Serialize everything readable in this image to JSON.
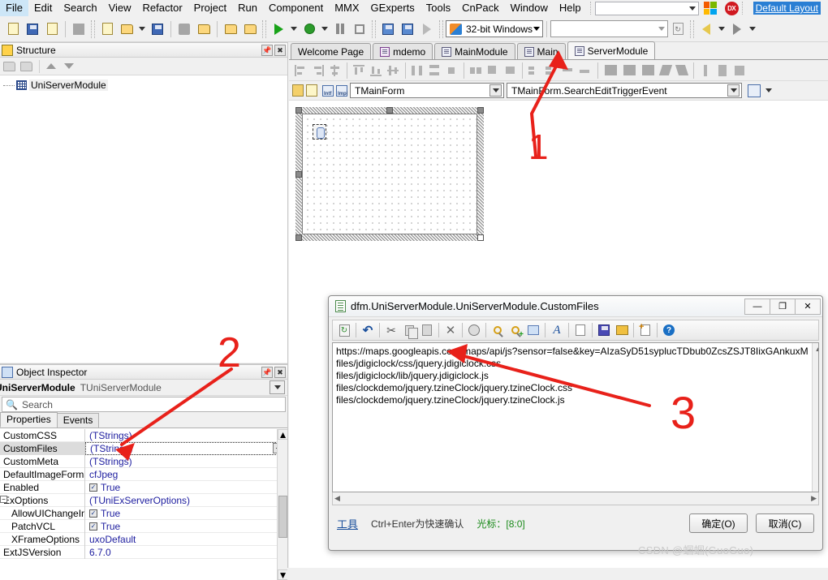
{
  "menubar": {
    "items": [
      "File",
      "Edit",
      "Search",
      "View",
      "Refactor",
      "Project",
      "Run",
      "Component",
      "MMX",
      "GExperts",
      "Tools",
      "CnPack",
      "Window",
      "Help"
    ],
    "combo_value": "",
    "layout_label": "Default Layout",
    "dx_badge": "DX"
  },
  "toolbar": {
    "platform_combo": "32-bit Windows",
    "config_combo": "",
    "icons": [
      "open-file-icon",
      "open-project-icon",
      "reopen-icon",
      "stop-icon",
      "new-icon",
      "new-other-icon",
      "save-icon",
      "close-icon",
      "close-all-icon",
      "save-all-icon",
      "save-project-icon",
      "run-icon",
      "run-options-icon",
      "debug-icon",
      "debug-options-icon",
      "pause-icon",
      "program-reset-icon",
      "trace-into-icon",
      "step-over-icon",
      "run-to-cursor-icon",
      "vista-platform-icon",
      "refresh-icon",
      "back-icon",
      "forward-icon"
    ]
  },
  "structure": {
    "title": "Structure",
    "pin_icon": "pin-icon",
    "close_icon": "close-icon",
    "tools": [
      "collapse-icon",
      "expand-icon",
      "move-up-icon",
      "move-down-icon"
    ],
    "tree": [
      {
        "label": "UniServerModule",
        "icon": "module-grid-icon"
      }
    ]
  },
  "editor": {
    "tabs": [
      {
        "label": "Welcome Page",
        "icon": null,
        "active": false
      },
      {
        "label": "mdemo",
        "icon": "project-icon",
        "active": false
      },
      {
        "label": "MainModule",
        "icon": "form-icon",
        "active": false
      },
      {
        "label": "Main",
        "icon": "form-icon",
        "active": false
      },
      {
        "label": "ServerModule",
        "icon": "form-icon",
        "active": true
      }
    ],
    "class_combo": "TMainForm",
    "member_combo": "TMainForm.SearchEditTriggerEvent",
    "designer_icons": [
      "align-left-icon",
      "align-right-icon",
      "align-center-icon",
      "align-top-icon",
      "align-bottom-icon",
      "align-middle-icon",
      "space-h-icon",
      "space-v-icon",
      "center-h-icon",
      "center-v-icon",
      "scale-icon",
      "size-icon",
      "tab-order-icon",
      "creation-order-icon",
      "bring-front-icon",
      "send-back-icon",
      "lock-icon",
      "flip-children-icon",
      "grid-snap-icon",
      "grid-show-icon",
      "align-to-grid-icon"
    ]
  },
  "inspector": {
    "title": "Object Inspector",
    "pin_icon": "pin-icon",
    "close_icon": "close-icon",
    "object_name": "UniServerModule",
    "object_class": "TUniServerModule",
    "search_placeholder": "Search",
    "tabs": [
      {
        "label": "Properties",
        "active": true
      },
      {
        "label": "Events",
        "active": false
      }
    ],
    "rows": [
      {
        "name": "CustomCSS",
        "value": "(TStrings)",
        "kind": "text",
        "indent": false,
        "selected": false
      },
      {
        "name": "CustomFiles",
        "value": "(TStrings)",
        "kind": "ellipsis",
        "indent": false,
        "selected": true
      },
      {
        "name": "CustomMeta",
        "value": "(TStrings)",
        "kind": "text",
        "indent": false,
        "selected": false
      },
      {
        "name": "DefaultImageForma",
        "value": "cfJpeg",
        "kind": "text",
        "indent": false,
        "selected": false
      },
      {
        "name": "Enabled",
        "value": "True",
        "kind": "check",
        "indent": false,
        "selected": false
      },
      {
        "name": "ExOptions",
        "value": "(TUniExServerOptions)",
        "kind": "text",
        "indent": false,
        "selected": false
      },
      {
        "name": "AllowUIChangeInI",
        "value": "True",
        "kind": "check",
        "indent": true,
        "selected": false
      },
      {
        "name": "PatchVCL",
        "value": "True",
        "kind": "check",
        "indent": true,
        "selected": false
      },
      {
        "name": "XFrameOptions",
        "value": "uxoDefault",
        "kind": "text",
        "indent": true,
        "selected": false
      },
      {
        "name": "ExtJSVersion",
        "value": "6.7.0",
        "kind": "text",
        "indent": false,
        "selected": false
      }
    ]
  },
  "dialog": {
    "title": "dfm.UniServerModule.UniServerModule.CustomFiles",
    "doc_icon": "document-icon",
    "window_buttons": [
      {
        "name": "minimize-button",
        "glyph": "—"
      },
      {
        "name": "maximize-button",
        "glyph": "❐"
      },
      {
        "name": "close-button",
        "glyph": "✕"
      }
    ],
    "toolbar_icons": [
      "refresh-icon",
      "undo-icon",
      "cut-icon",
      "copy-icon",
      "paste-icon",
      "delete-icon",
      "clear-icon",
      "find-icon",
      "find-next-icon",
      "replace-icon",
      "font-icon",
      "format-icon",
      "save-icon",
      "open-icon",
      "new-icon",
      "help-icon"
    ],
    "lines": [
      "https://maps.googleapis.com/maps/api/js?sensor=false&key=AIzaSyD51syplucTDbub0ZcsZSJT8IixGAnkuxM",
      "files/jdigiclock/css/jquery.jdigiclock.css",
      "files/jdigiclock/lib/jquery.jdigiclock.js",
      "files/clockdemo/jquery.tzineClock/jquery.tzineClock.css",
      "files/clockdemo/jquery.tzineClock/jquery.tzineClock.js"
    ],
    "status": {
      "tools_link": "工具",
      "hint": "Ctrl+Enter为快速确认",
      "cursor": "光标：[8:0]"
    },
    "ok_label": "确定(O)",
    "cancel_label": "取消(C)"
  },
  "annotations": [
    {
      "label": "1",
      "name": "annotation-1"
    },
    {
      "label": "2",
      "name": "annotation-2"
    },
    {
      "label": "3",
      "name": "annotation-3"
    }
  ],
  "watermark": "CSDN @蝈蝈(GuoGuo)",
  "colors": {
    "annotation": "#e8211a",
    "accent_blue": "#2a7fd4",
    "property_value": "#2020a0",
    "cursor_green": "#1a8a1a"
  }
}
